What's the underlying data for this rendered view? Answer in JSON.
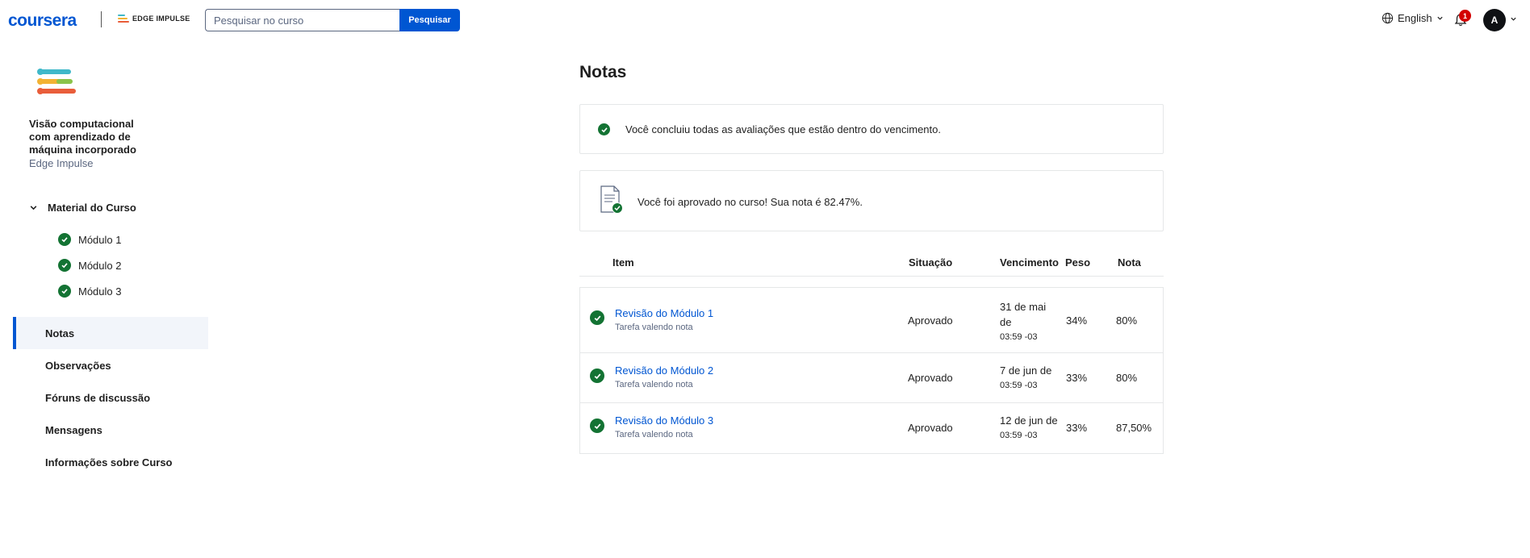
{
  "header": {
    "logo": "coursera",
    "partner": "EDGE IMPULSE",
    "search_placeholder": "Pesquisar no curso",
    "search_button": "Pesquisar",
    "language": "English",
    "notification_count": "1",
    "avatar_initial": "A"
  },
  "sidebar": {
    "course_title": "Visão computacional com aprendizado de máquina incorporado",
    "course_partner": "Edge Impulse",
    "material_label": "Material do Curso",
    "modules": [
      {
        "label": "Módulo 1"
      },
      {
        "label": "Módulo 2"
      },
      {
        "label": "Módulo 3"
      }
    ],
    "nav": [
      {
        "label": "Notas",
        "active": true
      },
      {
        "label": "Observações"
      },
      {
        "label": "Fóruns de discussão"
      },
      {
        "label": "Mensagens"
      },
      {
        "label": "Informações sobre Curso"
      }
    ]
  },
  "main": {
    "title": "Notas",
    "notice_completed": "Você concluiu todas as avaliações que estão dentro do vencimento.",
    "notice_passed": "Você foi aprovado no curso! Sua nota é 82.47%.",
    "columns": {
      "item": "Item",
      "status": "Situação",
      "due": "Vencimento",
      "weight": "Peso",
      "grade": "Nota"
    },
    "rows": [
      {
        "title": "Revisão do Módulo 1",
        "subtitle": "Tarefa valendo nota",
        "status": "Aprovado",
        "due_date": "31 de mai de",
        "due_time": "03:59 -03",
        "weight": "34%",
        "grade": "80%"
      },
      {
        "title": "Revisão do Módulo 2",
        "subtitle": "Tarefa valendo nota",
        "status": "Aprovado",
        "due_date": "7 de jun de",
        "due_time": "03:59 -03",
        "weight": "33%",
        "grade": "80%"
      },
      {
        "title": "Revisão do Módulo 3",
        "subtitle": "Tarefa valendo nota",
        "status": "Aprovado",
        "due_date": "12 de jun de",
        "due_time": "03:59 -03",
        "weight": "33%",
        "grade": "87,50%"
      }
    ]
  },
  "colors": {
    "brand": "#0056d2",
    "success": "#137333",
    "badge": "#d30001"
  }
}
